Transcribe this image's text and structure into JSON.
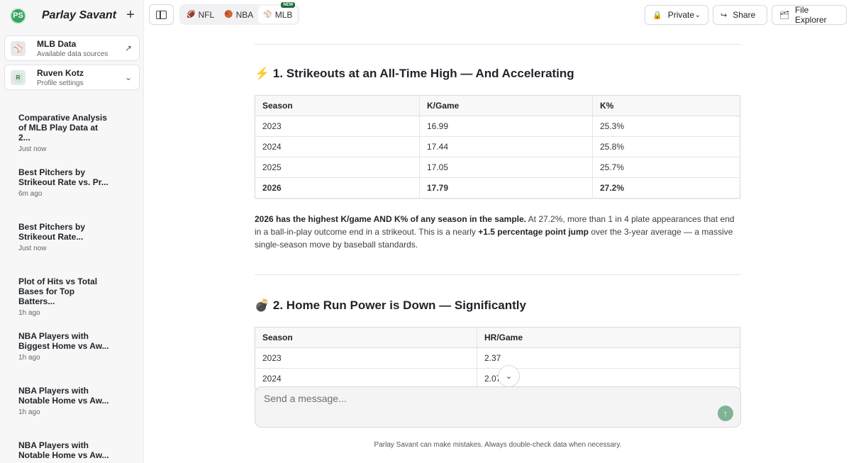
{
  "app": {
    "name": "Parlay Savant",
    "logo_text": "PS"
  },
  "sidebar": {
    "data_card": {
      "title": "MLB Data",
      "subtitle": "Available data sources",
      "icon": "baseball-icon"
    },
    "profile_card": {
      "title": "Ruven Kotz",
      "subtitle": "Profile settings",
      "avatar_letter": "R"
    },
    "conversations": [
      {
        "title": "Comparative Analysis of MLB Play Data at 2...",
        "time": "Just now"
      },
      {
        "title": "Best Pitchers by Strikeout Rate vs. Pr...",
        "time": "6m ago"
      },
      {
        "title": "Best Pitchers by Strikeout Rate...",
        "time": "Just now"
      },
      {
        "title": "Plot of Hits vs Total Bases for Top Batters...",
        "time": "1h ago"
      },
      {
        "title": "NBA Players with Biggest Home vs Aw...",
        "time": "1h ago"
      },
      {
        "title": "NBA Players with Notable Home vs Aw...",
        "time": "1h ago"
      },
      {
        "title": "NBA Players with Notable Home vs Aw...",
        "time": ""
      }
    ]
  },
  "topbar": {
    "tabs": [
      {
        "label": "NFL",
        "emoji": "🏈"
      },
      {
        "label": "NBA",
        "emoji": "🏀"
      },
      {
        "label": "MLB",
        "emoji": "⚾",
        "badge": "NEW"
      }
    ],
    "private_label": "Private",
    "share_label": "Share",
    "file_explorer_label": "File Explorer"
  },
  "sections": [
    {
      "emoji": "⚡",
      "title": "1. Strikeouts at an All-Time High — And Accelerating",
      "headers": [
        "Season",
        "K/Game",
        "K%"
      ],
      "rows": [
        [
          "2023",
          "16.99",
          "25.3%"
        ],
        [
          "2024",
          "17.44",
          "25.8%"
        ],
        [
          "2025",
          "17.05",
          "25.7%"
        ],
        [
          "2026",
          "17.79",
          "27.2%"
        ]
      ],
      "para": {
        "b1": "2026 has the highest K/game AND K% of any season in the sample.",
        "t1": " At 27.2%, more than 1 in 4 plate appearances that end in a ball-in-play outcome end in a strikeout. This is a nearly ",
        "b2": "+1.5 percentage point jump",
        "t2": " over the 3-year average — a massive single-season move by baseball standards."
      }
    },
    {
      "emoji": "💣",
      "title": "2. Home Run Power is Down — Significantly",
      "headers": [
        "Season",
        "HR/Game"
      ],
      "rows": [
        [
          "2023",
          "2.37"
        ],
        [
          "2024",
          "2.07"
        ]
      ]
    }
  ],
  "composer": {
    "placeholder": "Send a message...",
    "send_icon": "arrow-up-icon",
    "scroll_icon": "chevron-down-icon"
  },
  "disclaimer": "Parlay Savant can make mistakes. Always double-check data when necessary.",
  "colors": {
    "brand": "#3aa363",
    "send": "#7fb394",
    "badge": "#1f6b3c"
  }
}
